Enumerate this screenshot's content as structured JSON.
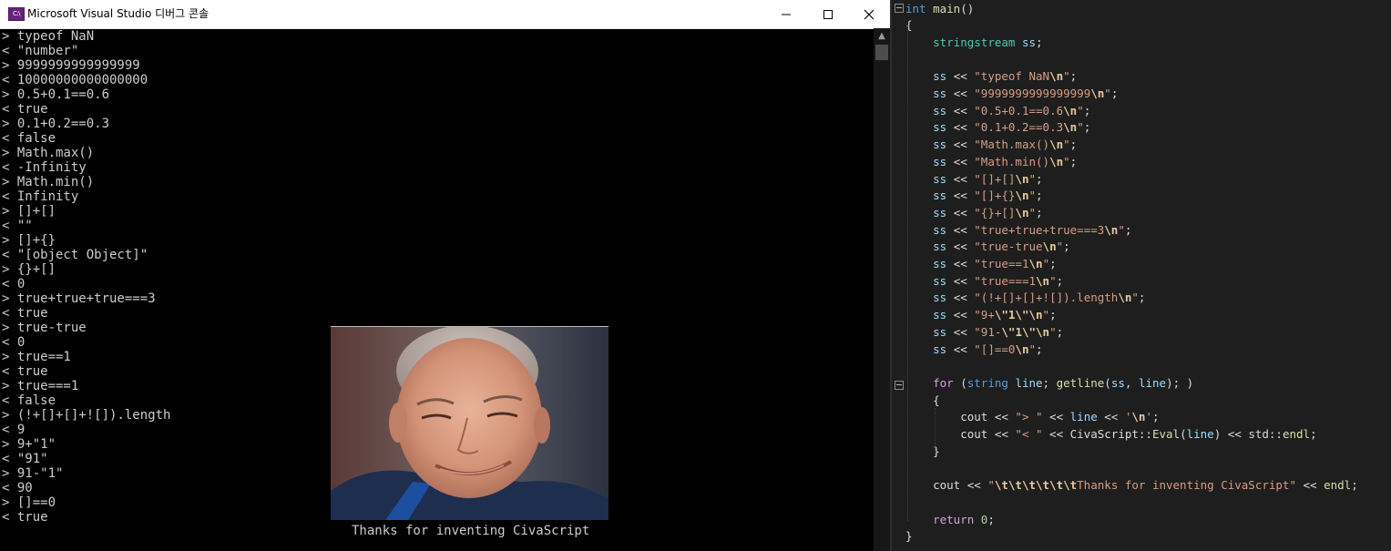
{
  "console": {
    "title": "Microsoft Visual Studio 디버그 콘솔",
    "app_icon_label": "C:\\",
    "scroll_up_glyph": "▲",
    "lines": [
      "> typeof NaN",
      "< \"number\"",
      "> 9999999999999999",
      "< 10000000000000000",
      "> 0.5+0.1==0.6",
      "< true",
      "> 0.1+0.2==0.3",
      "< false",
      "> Math.max()",
      "< -Infinity",
      "> Math.min()",
      "< Infinity",
      "> []+[]",
      "< \"\"",
      "> []+{}",
      "< \"[object Object]\"",
      "> {}+[]",
      "< 0",
      "> true+true+true===3",
      "< true",
      "> true-true",
      "< 0",
      "> true==1",
      "< true",
      "> true===1",
      "< false",
      "> (!+[]+[]+![]).length",
      "< 9",
      "> 9+\"1\"",
      "< \"91\"",
      "> 91-\"1\"",
      "< 90",
      "> []==0",
      "< true"
    ],
    "caption": "Thanks for inventing CivaScript"
  },
  "editor": {
    "lines": [
      {
        "tokens": [
          [
            "kw",
            "int"
          ],
          [
            "op",
            " "
          ],
          [
            "fn",
            "main"
          ],
          [
            "op",
            "()"
          ]
        ]
      },
      {
        "tokens": [
          [
            "op",
            "{"
          ]
        ]
      },
      {
        "tokens": [
          [
            "op",
            "    "
          ],
          [
            "ty",
            "stringstream"
          ],
          [
            "op",
            " "
          ],
          [
            "var",
            "ss"
          ],
          [
            "op",
            ";"
          ]
        ]
      },
      {
        "tokens": []
      },
      {
        "tokens": [
          [
            "op",
            "    "
          ],
          [
            "var",
            "ss"
          ],
          [
            "op",
            " << "
          ],
          [
            "str",
            "\"typeof NaN"
          ],
          [
            "esc",
            "\\n"
          ],
          [
            "str",
            "\""
          ],
          [
            "op",
            ";"
          ]
        ]
      },
      {
        "tokens": [
          [
            "op",
            "    "
          ],
          [
            "var",
            "ss"
          ],
          [
            "op",
            " << "
          ],
          [
            "str",
            "\"9999999999999999"
          ],
          [
            "esc",
            "\\n"
          ],
          [
            "str",
            "\""
          ],
          [
            "op",
            ";"
          ]
        ]
      },
      {
        "tokens": [
          [
            "op",
            "    "
          ],
          [
            "var",
            "ss"
          ],
          [
            "op",
            " << "
          ],
          [
            "str",
            "\"0.5+0.1==0.6"
          ],
          [
            "esc",
            "\\n"
          ],
          [
            "str",
            "\""
          ],
          [
            "op",
            ";"
          ]
        ]
      },
      {
        "tokens": [
          [
            "op",
            "    "
          ],
          [
            "var",
            "ss"
          ],
          [
            "op",
            " << "
          ],
          [
            "str",
            "\"0.1+0.2==0.3"
          ],
          [
            "esc",
            "\\n"
          ],
          [
            "str",
            "\""
          ],
          [
            "op",
            ";"
          ]
        ]
      },
      {
        "tokens": [
          [
            "op",
            "    "
          ],
          [
            "var",
            "ss"
          ],
          [
            "op",
            " << "
          ],
          [
            "str",
            "\"Math.max()"
          ],
          [
            "esc",
            "\\n"
          ],
          [
            "str",
            "\""
          ],
          [
            "op",
            ";"
          ]
        ]
      },
      {
        "tokens": [
          [
            "op",
            "    "
          ],
          [
            "var",
            "ss"
          ],
          [
            "op",
            " << "
          ],
          [
            "str",
            "\"Math.min()"
          ],
          [
            "esc",
            "\\n"
          ],
          [
            "str",
            "\""
          ],
          [
            "op",
            ";"
          ]
        ]
      },
      {
        "tokens": [
          [
            "op",
            "    "
          ],
          [
            "var",
            "ss"
          ],
          [
            "op",
            " << "
          ],
          [
            "str",
            "\"[]+[]"
          ],
          [
            "esc",
            "\\n"
          ],
          [
            "str",
            "\""
          ],
          [
            "op",
            ";"
          ]
        ]
      },
      {
        "tokens": [
          [
            "op",
            "    "
          ],
          [
            "var",
            "ss"
          ],
          [
            "op",
            " << "
          ],
          [
            "str",
            "\"[]+{}"
          ],
          [
            "esc",
            "\\n"
          ],
          [
            "str",
            "\""
          ],
          [
            "op",
            ";"
          ]
        ]
      },
      {
        "tokens": [
          [
            "op",
            "    "
          ],
          [
            "var",
            "ss"
          ],
          [
            "op",
            " << "
          ],
          [
            "str",
            "\"{}+[]"
          ],
          [
            "esc",
            "\\n"
          ],
          [
            "str",
            "\""
          ],
          [
            "op",
            ";"
          ]
        ]
      },
      {
        "tokens": [
          [
            "op",
            "    "
          ],
          [
            "var",
            "ss"
          ],
          [
            "op",
            " << "
          ],
          [
            "str",
            "\"true+true+true===3"
          ],
          [
            "esc",
            "\\n"
          ],
          [
            "str",
            "\""
          ],
          [
            "op",
            ";"
          ]
        ]
      },
      {
        "tokens": [
          [
            "op",
            "    "
          ],
          [
            "var",
            "ss"
          ],
          [
            "op",
            " << "
          ],
          [
            "str",
            "\"true-true"
          ],
          [
            "esc",
            "\\n"
          ],
          [
            "str",
            "\""
          ],
          [
            "op",
            ";"
          ]
        ]
      },
      {
        "tokens": [
          [
            "op",
            "    "
          ],
          [
            "var",
            "ss"
          ],
          [
            "op",
            " << "
          ],
          [
            "str",
            "\"true==1"
          ],
          [
            "esc",
            "\\n"
          ],
          [
            "str",
            "\""
          ],
          [
            "op",
            ";"
          ]
        ]
      },
      {
        "tokens": [
          [
            "op",
            "    "
          ],
          [
            "var",
            "ss"
          ],
          [
            "op",
            " << "
          ],
          [
            "str",
            "\"true===1"
          ],
          [
            "esc",
            "\\n"
          ],
          [
            "str",
            "\""
          ],
          [
            "op",
            ";"
          ]
        ]
      },
      {
        "tokens": [
          [
            "op",
            "    "
          ],
          [
            "var",
            "ss"
          ],
          [
            "op",
            " << "
          ],
          [
            "str",
            "\"(!+[]+[]+![]).length"
          ],
          [
            "esc",
            "\\n"
          ],
          [
            "str",
            "\""
          ],
          [
            "op",
            ";"
          ]
        ]
      },
      {
        "tokens": [
          [
            "op",
            "    "
          ],
          [
            "var",
            "ss"
          ],
          [
            "op",
            " << "
          ],
          [
            "str",
            "\"9+"
          ],
          [
            "esc",
            "\\\"1\\\"\\n"
          ],
          [
            "str",
            "\""
          ],
          [
            "op",
            ";"
          ]
        ]
      },
      {
        "tokens": [
          [
            "op",
            "    "
          ],
          [
            "var",
            "ss"
          ],
          [
            "op",
            " << "
          ],
          [
            "str",
            "\"91-"
          ],
          [
            "esc",
            "\\\"1\\\"\\n"
          ],
          [
            "str",
            "\""
          ],
          [
            "op",
            ";"
          ]
        ]
      },
      {
        "tokens": [
          [
            "op",
            "    "
          ],
          [
            "var",
            "ss"
          ],
          [
            "op",
            " << "
          ],
          [
            "str",
            "\"[]==0"
          ],
          [
            "esc",
            "\\n"
          ],
          [
            "str",
            "\""
          ],
          [
            "op",
            ";"
          ]
        ]
      },
      {
        "tokens": []
      },
      {
        "tokens": [
          [
            "op",
            "    "
          ],
          [
            "ctrl",
            "for"
          ],
          [
            "op",
            " ("
          ],
          [
            "kw",
            "string"
          ],
          [
            "op",
            " "
          ],
          [
            "var",
            "line"
          ],
          [
            "op",
            "; "
          ],
          [
            "fn",
            "getline"
          ],
          [
            "op",
            "("
          ],
          [
            "var",
            "ss"
          ],
          [
            "op",
            ", "
          ],
          [
            "var",
            "line"
          ],
          [
            "op",
            "); )"
          ]
        ]
      },
      {
        "tokens": [
          [
            "op",
            "    {"
          ]
        ]
      },
      {
        "tokens": [
          [
            "op",
            "        cout << "
          ],
          [
            "str",
            "\"> \""
          ],
          [
            "op",
            " << "
          ],
          [
            "var",
            "line"
          ],
          [
            "op",
            " << "
          ],
          [
            "str",
            "'"
          ],
          [
            "esc",
            "\\n"
          ],
          [
            "str",
            "'"
          ],
          [
            "op",
            ";"
          ]
        ]
      },
      {
        "tokens": [
          [
            "op",
            "        cout << "
          ],
          [
            "str",
            "\"< \""
          ],
          [
            "op",
            " << CivaScript::"
          ],
          [
            "fn",
            "Eval"
          ],
          [
            "op",
            "("
          ],
          [
            "var",
            "line"
          ],
          [
            "op",
            ") << std::"
          ],
          [
            "fn",
            "endl"
          ],
          [
            "op",
            ";"
          ]
        ]
      },
      {
        "tokens": [
          [
            "op",
            "    }"
          ]
        ]
      },
      {
        "tokens": []
      },
      {
        "tokens": [
          [
            "op",
            "    cout << "
          ],
          [
            "str",
            "\""
          ],
          [
            "esc",
            "\\t\\t\\t\\t\\t\\t"
          ],
          [
            "str",
            "Thanks for inventing CivaScript\""
          ],
          [
            "op",
            " << "
          ],
          [
            "fn",
            "endl"
          ],
          [
            "op",
            ";"
          ]
        ]
      },
      {
        "tokens": []
      },
      {
        "tokens": [
          [
            "op",
            "    "
          ],
          [
            "ctrl",
            "return"
          ],
          [
            "op",
            " "
          ],
          [
            "num",
            "0"
          ],
          [
            "op",
            ";"
          ]
        ]
      },
      {
        "tokens": [
          [
            "op",
            "}"
          ]
        ]
      }
    ]
  },
  "colors": {
    "console_bg": "#000000",
    "console_text": "#cccccc",
    "editor_bg": "#1e1e1e"
  }
}
